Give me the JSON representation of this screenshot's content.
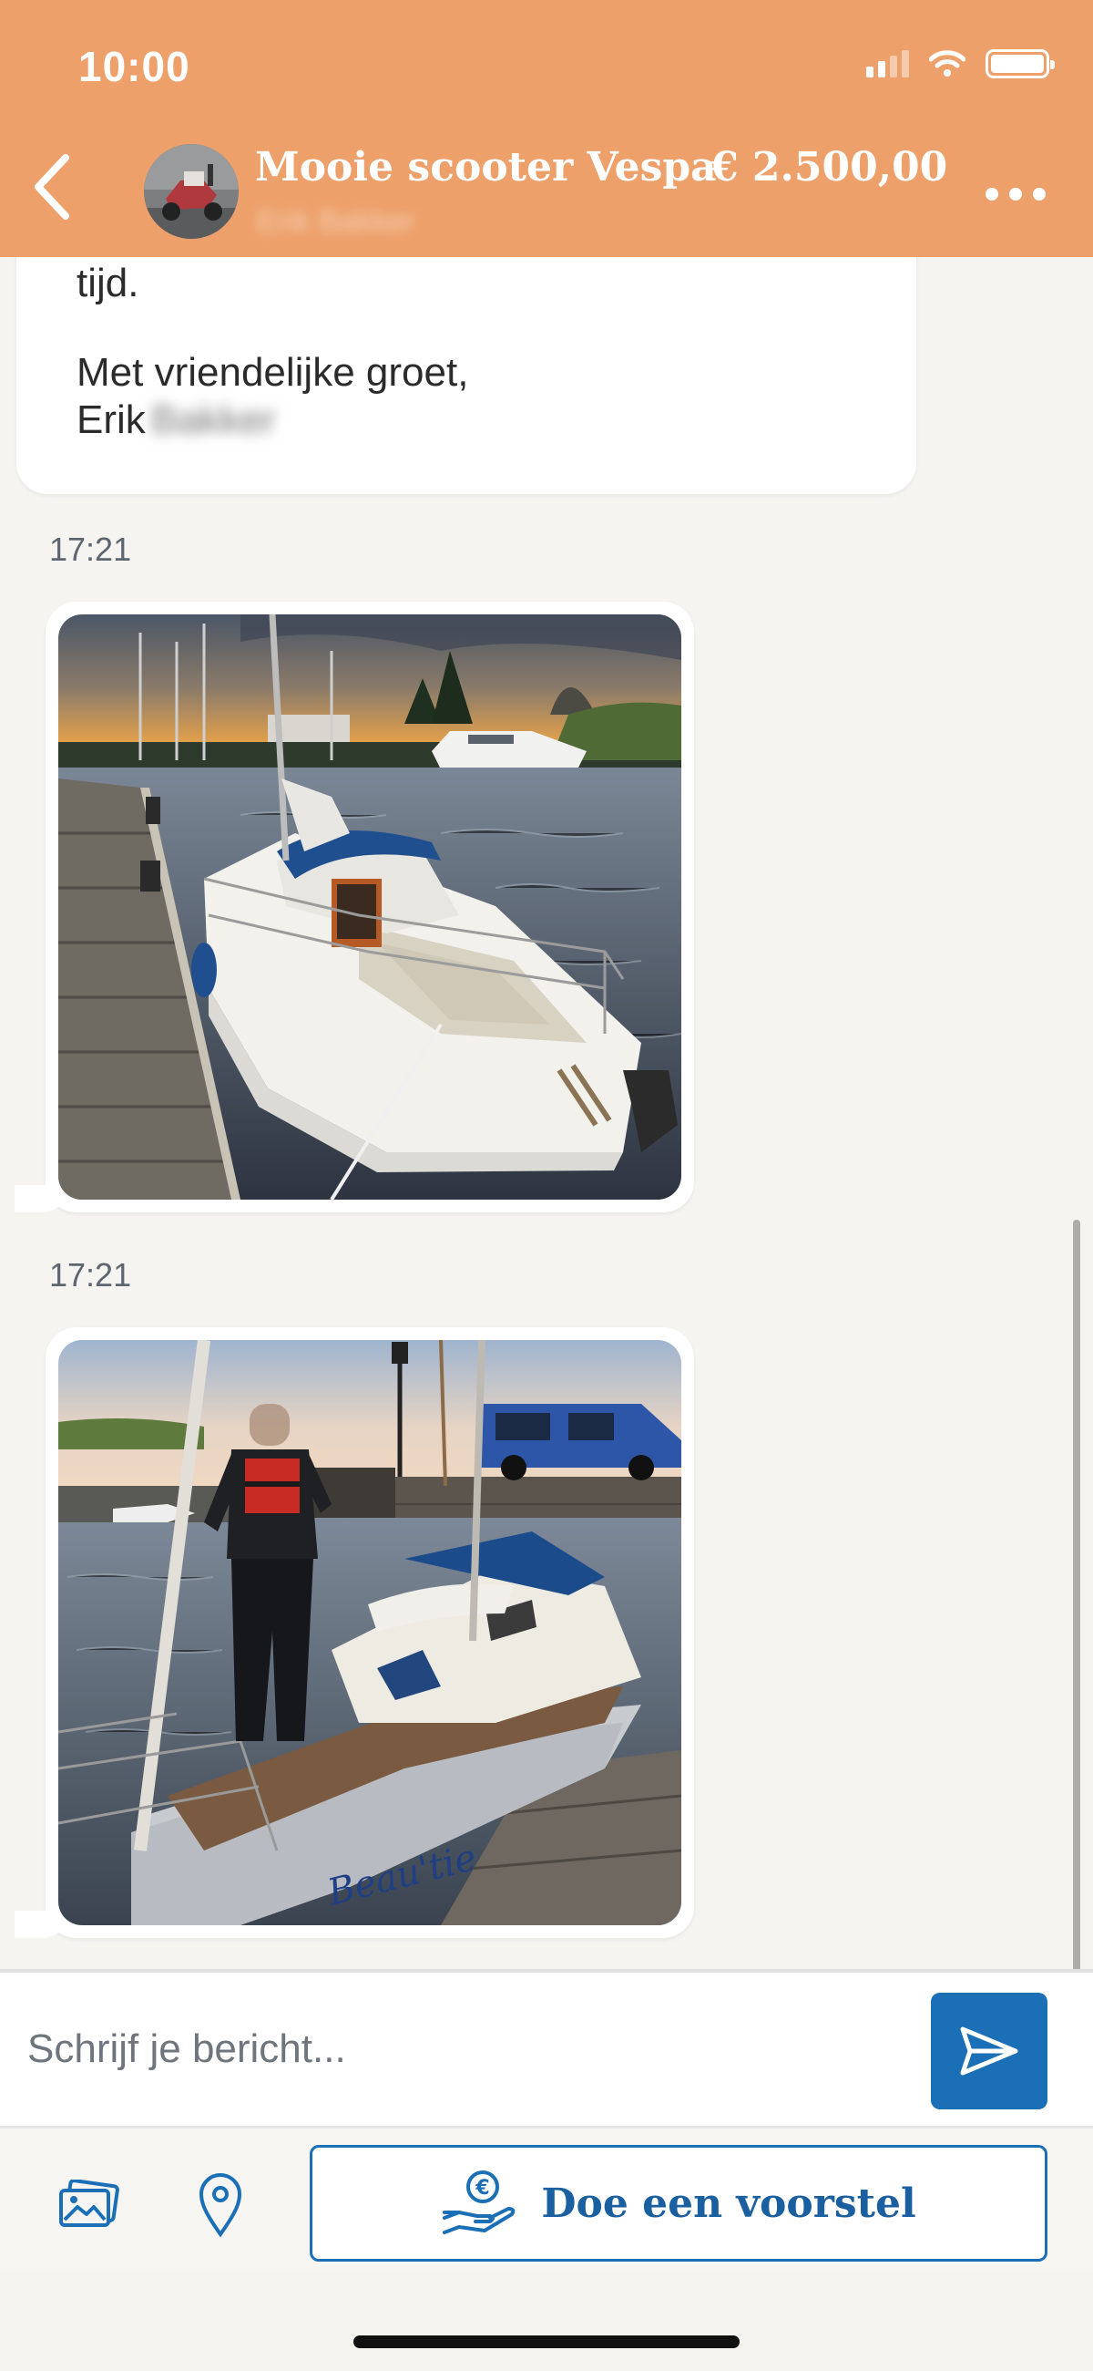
{
  "status_bar": {
    "time": "10:00"
  },
  "header": {
    "title": "Mooie scooter Vespa",
    "price": "€ 2.500,00",
    "seller_name": "Erik Bakker"
  },
  "messages": {
    "text_line_1": "tijd.",
    "text_line_2": "Met vriendelijke groet,",
    "text_line_3_name": "Erik",
    "text_line_3_blurred": "Bakker",
    "photo_1_time": "17:21",
    "photo_2_time": "17:21",
    "photo_2_boat_name": "Beau'tie"
  },
  "composer": {
    "placeholder": "Schrijf je bericht..."
  },
  "actions": {
    "offer_label": "Doe een voorstel"
  },
  "colors": {
    "header": "#eda06a",
    "accent": "#1a6fb6",
    "background": "#f5f4f1"
  },
  "icons": [
    "back-icon",
    "more-icon",
    "send-icon",
    "gallery-icon",
    "location-icon",
    "euro-hand-icon"
  ]
}
